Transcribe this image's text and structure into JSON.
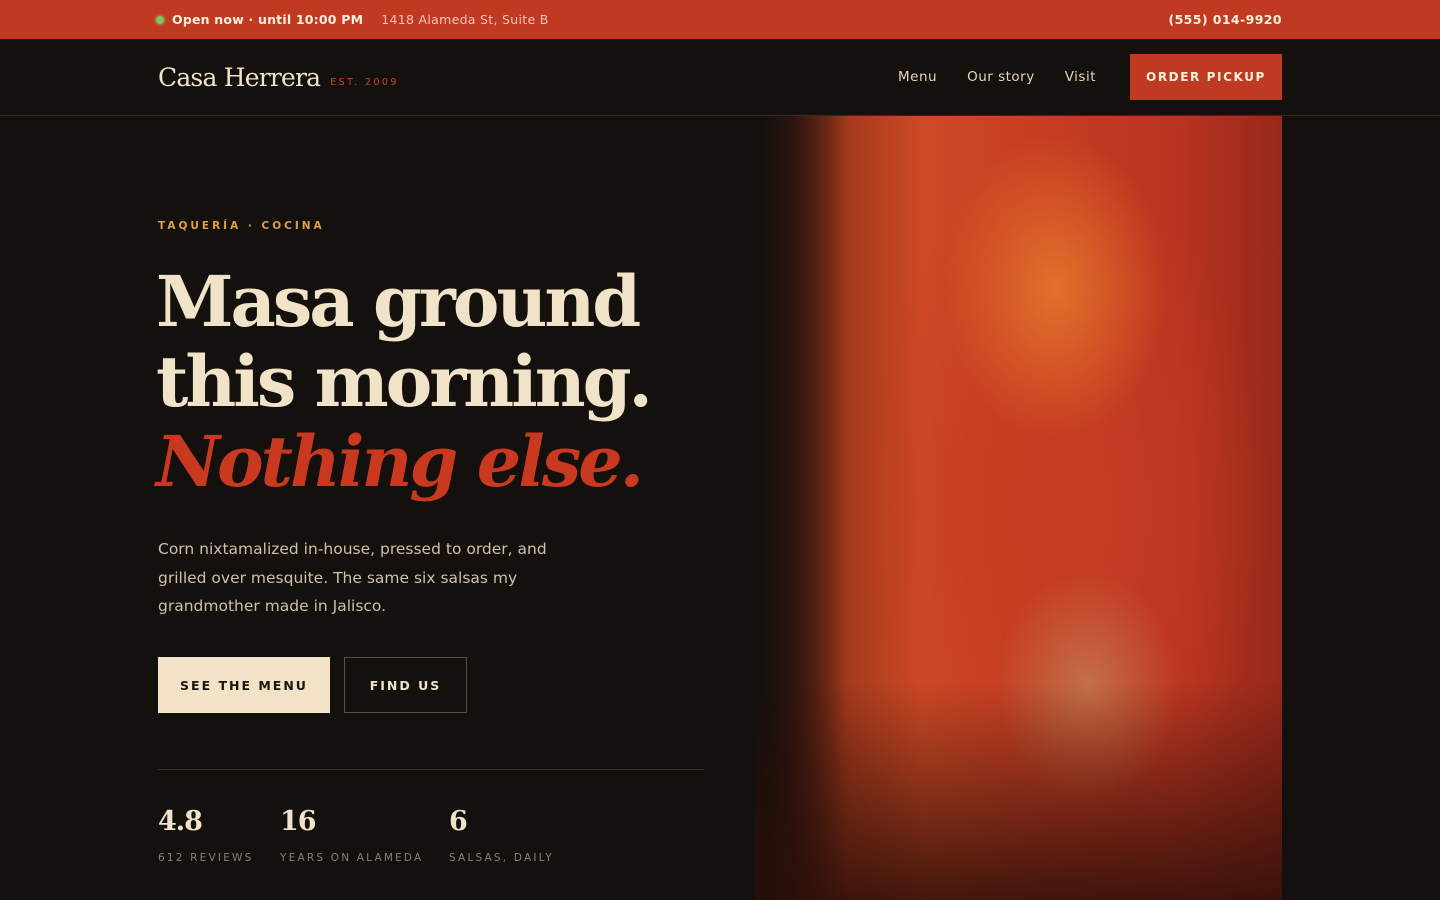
{
  "topbar": {
    "status": "Open now · until 10:00 PM",
    "address": "1418 Alameda St, Suite B",
    "phone": "(555) 014-9920"
  },
  "nav": {
    "brand": "Casa Herrera",
    "est": "EST. 2009",
    "links": [
      "Menu",
      "Our story",
      "Visit"
    ],
    "cta": "ORDER PICKUP"
  },
  "hero": {
    "eyebrow": "TAQUERÍA · COCINA",
    "headline_line1": "Masa ground",
    "headline_line2": "this morning.",
    "headline_accent": "Nothing else.",
    "lede": "Corn nixtamalized in-house, pressed to order, and grilled over mesquite. The same six salsas my grandmother made in Jalisco.",
    "primary_button": "SEE THE MENU",
    "secondary_button": "FIND US"
  },
  "stats": [
    {
      "value": "4.8",
      "label": "612 REVIEWS"
    },
    {
      "value": "16",
      "label": "YEARS ON ALAMEDA"
    },
    {
      "value": "6",
      "label": "SALSAS, DAILY"
    }
  ],
  "colors": {
    "brand_red": "#c03a22",
    "background": "#14100d",
    "cream": "#f1e3c8",
    "accent_gold": "#e0a13a",
    "status_green": "#7fc462"
  }
}
